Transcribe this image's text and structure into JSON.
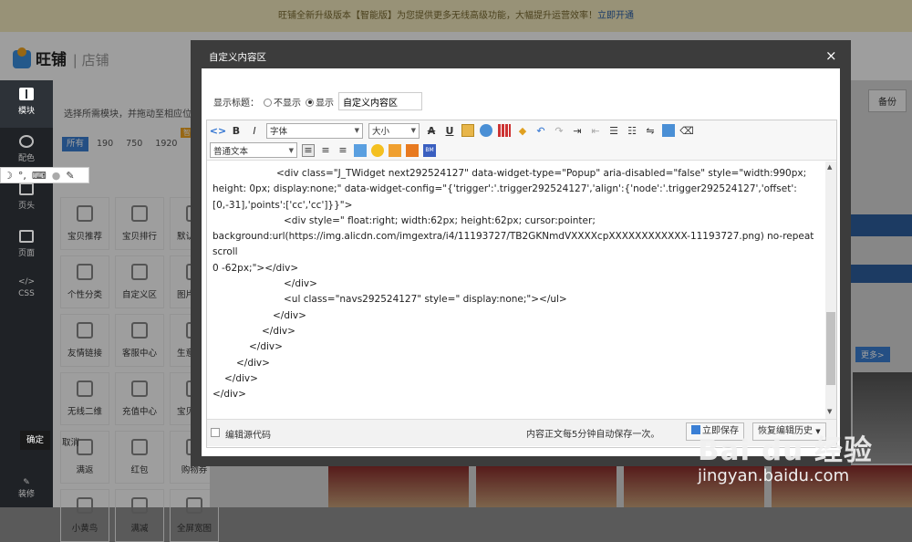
{
  "topbar": {
    "text": "旺铺全新升级版本【智能版】为您提供更多无线高级功能，大幅提升运营效率！",
    "link": "立即开通"
  },
  "header": {
    "brand": "旺铺",
    "sub": "店铺"
  },
  "leftbar": {
    "items": [
      {
        "label": "模块",
        "icon": "grid-icon"
      },
      {
        "label": "配色",
        "icon": "palette-icon"
      },
      {
        "label": "页头",
        "icon": "header-icon"
      },
      {
        "label": "页面",
        "icon": "page-icon"
      },
      {
        "label": "CSS",
        "icon": "code-icon"
      }
    ],
    "bottom": "装修"
  },
  "panel": {
    "tip": "选择所需模块，并拖动至相应位置",
    "filters": [
      "所有",
      "190",
      "750",
      "1920"
    ],
    "new_badge": "智能版",
    "section": "模块",
    "tiles": [
      "宝贝推荐",
      "宝贝排行",
      "默认分类",
      "个性分类",
      "自定义区",
      "图片轮播",
      "友情链接",
      "客服中心",
      "生意参谋",
      "无线二维",
      "充值中心",
      "宝贝搜索",
      "满返",
      "红包",
      "购物券",
      "小黄鸟",
      "满减",
      "全屏宽图"
    ]
  },
  "canvas": {
    "backup": "备份",
    "more": "更多>"
  },
  "modal": {
    "title": "自定义内容区",
    "show_title_label": "显示标题：",
    "hide_option": "不显示",
    "show_option": "显示",
    "title_value": "自定义内容区",
    "font_family": "字体",
    "font_size": "大小",
    "paragraph": "普通文本",
    "code_lines": [
      "<div class=\"J_TWidget next292524127\" data-widget-type=\"Popup\" aria-disabled=\"false\" style=\"width:990px;",
      "height: 0px; display:none;\" data-widget-config=\"{'trigger':'.trigger292524127','align':{'node':'.trigger292524127','offset':",
      "[0,-31],'points':['cc','cc']}}\">",
      "<div style=\" float:right; width:62px; height:62px; cursor:pointer;",
      "background:url(https://img.alicdn.com/imgextra/i4/11193727/TB2GKNmdVXXXXcpXXXXXXXXXXXX-11193727.png) no-repeat scroll",
      "0 -62px;\"></div>",
      "</div>",
      "<ul class=\"navs292524127\" style=\" display:none;\"></ul>",
      "</div>",
      "</div>",
      "</div>",
      "</div>",
      "</div>",
      "</div>"
    ],
    "edit_source": "编辑源代码",
    "autosave_note": "内容正文每5分钟自动保存一次。",
    "save_now": "立即保存",
    "restore_history": "恢复编辑历史",
    "ok": "确定",
    "cancel": "取消",
    "close": "×"
  },
  "watermark": {
    "line1": "Bai du 经验",
    "line2": "jingyan.baidu.com"
  }
}
